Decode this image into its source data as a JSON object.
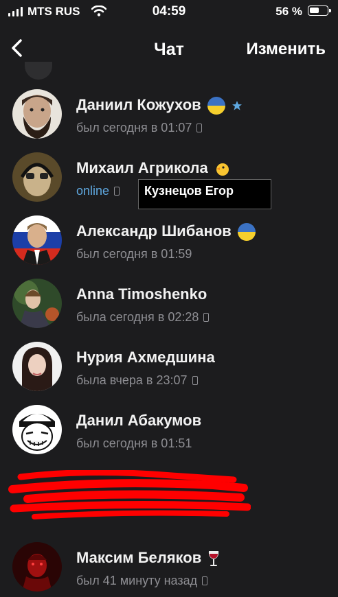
{
  "status_bar": {
    "carrier": "MTS RUS",
    "time": "04:59",
    "battery_percent": "56 %",
    "battery_level": 0.56
  },
  "nav": {
    "back_icon": "chevron-left-icon",
    "title": "Чат",
    "edit_label": "Изменить"
  },
  "contacts": [
    {
      "name": "Даниил Кожухов",
      "status": "был сегодня в 01:07",
      "online": false,
      "badges": [
        "ukraine-flag-icon",
        "star-icon"
      ]
    },
    {
      "name": "Михаил Агрикола",
      "status": "online",
      "online": true,
      "badges": [
        "chick-emoji-icon"
      ]
    },
    {
      "name": "Александр Шибанов",
      "status": "был сегодня в 01:59",
      "online": false,
      "badges": [
        "ukraine-flag-icon"
      ]
    },
    {
      "name": "Anna Timoshenko",
      "status": "была сегодня в 02:28",
      "online": false,
      "badges": []
    },
    {
      "name": "Нурия Ахмедшина",
      "status": "была вчера в 23:07",
      "online": false,
      "badges": []
    },
    {
      "name": "Данил Абакумов",
      "status": "был сегодня в 01:51",
      "online": false,
      "badges": []
    },
    {
      "name": "Максим Беляков",
      "status": "был 41 минуту назад",
      "online": false,
      "badges": [
        "wine-glass-icon"
      ]
    }
  ],
  "tooltip": {
    "text": "Кузнецов Егор"
  },
  "colors": {
    "background": "#1c1c1e",
    "online": "#5fa8e0",
    "secondary": "#8e8e93",
    "redaction": "#ff0000"
  }
}
